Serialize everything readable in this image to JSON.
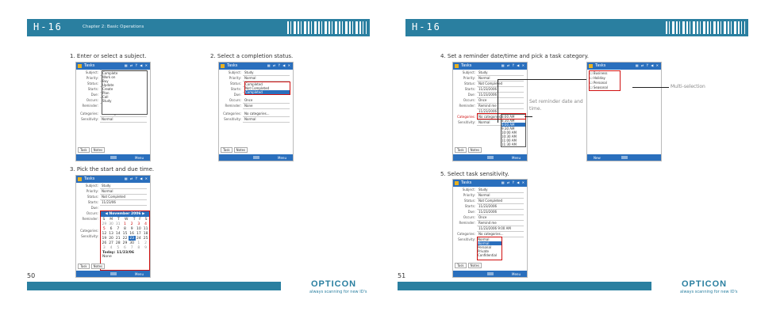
{
  "left_page": {
    "model": "H-16",
    "chapter": "Chapter 2: Basic Operations",
    "page_number": "50",
    "brand": "OPTICON",
    "tagline": "always scanning for new ID's",
    "steps": [
      "1. Enter or select a subject.",
      "2. Select a completion status.",
      "3. Pick the start and due time."
    ]
  },
  "right_page": {
    "model": "H-16",
    "page_number": "51",
    "brand": "OPTICON",
    "tagline": "always scanning for new ID's",
    "steps": [
      "4. Set a reminder date/time and pick a task category.",
      "5. Select task sensitivity."
    ],
    "annotations": {
      "reminder": "Set reminder date and time.",
      "multi": "Multi-selection"
    }
  },
  "device": {
    "app_title": "Tasks",
    "tab_task": "Task",
    "tab_notes": "Notes",
    "menu": "Menu",
    "new": "New",
    "labels": {
      "subject": "Subject:",
      "priority": "Priority:",
      "status": "Status:",
      "starts": "Starts:",
      "due": "Due:",
      "occurs": "Occurs:",
      "reminder": "Reminder:",
      "categories": "Categories:",
      "sensitivity": "Sensitivity:"
    },
    "values": {
      "subject": "Study",
      "priority": "Normal",
      "status": "Not Completed",
      "starts": "11/23/2006",
      "due": "11/23/2006",
      "starts_short": "11/23/06",
      "occurs": "Once",
      "reminder": "None",
      "reminder_set": "Remind me",
      "reminder_date": "11/23/2006",
      "reminder_time": "9:00 AM",
      "categories": "No categories...",
      "sensitivity": "Normal"
    },
    "subject_options": [
      "Complete",
      "Work on",
      "Buy",
      "Update",
      "Create",
      "Plan",
      "Call",
      "Study"
    ],
    "status_options": [
      "Completed",
      "Not Completed",
      "Completed"
    ],
    "time_options": [
      "8:00 AM",
      "8:30 AM",
      "9:00 AM",
      "9:30 AM",
      "10:00 AM",
      "10:30 AM",
      "11:00 AM",
      "11:30 AM"
    ],
    "time_selected": "9:00 AM",
    "category_options": [
      "Business",
      "Holiday",
      "Personal",
      "Seasonal"
    ],
    "sensitivity_options": [
      "Normal",
      "Normal",
      "Personal",
      "Private",
      "Confidential"
    ],
    "calendar": {
      "month": "November 2006",
      "weekdays": [
        "S",
        "M",
        "T",
        "W",
        "T",
        "F",
        "S"
      ],
      "weeks": [
        [
          "29",
          "30",
          "31",
          "1",
          "2",
          "3",
          "4"
        ],
        [
          "5",
          "6",
          "7",
          "8",
          "9",
          "10",
          "11"
        ],
        [
          "12",
          "13",
          "14",
          "15",
          "16",
          "17",
          "18"
        ],
        [
          "19",
          "20",
          "21",
          "22",
          "23",
          "24",
          "25"
        ],
        [
          "26",
          "27",
          "28",
          "29",
          "30",
          "1",
          "2"
        ],
        [
          "3",
          "4",
          "5",
          "6",
          "7",
          "8",
          "9"
        ]
      ],
      "selected_day": "23",
      "today": "Today: 11/23/06",
      "none": "None"
    }
  }
}
